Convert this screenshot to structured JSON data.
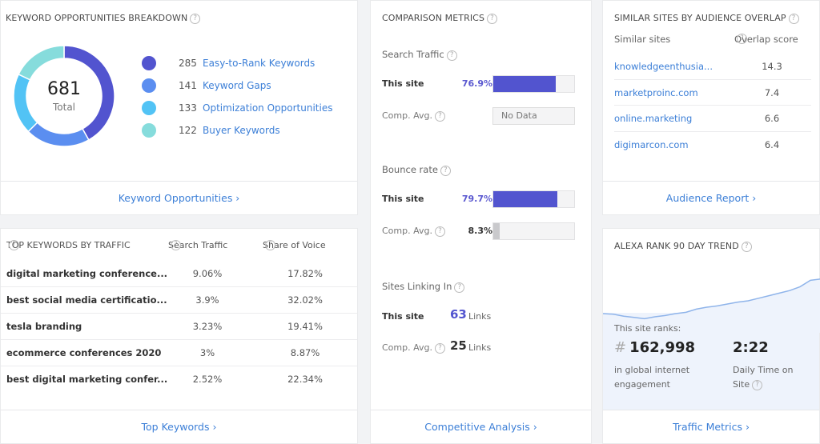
{
  "keyword_opportunities": {
    "title": "KEYWORD OPPORTUNITIES BREAKDOWN",
    "total": "681",
    "total_label": "Total",
    "items": [
      {
        "count": "285",
        "label": "Easy-to-Rank Keywords",
        "value": 285,
        "color": "#5254cf"
      },
      {
        "count": "141",
        "label": "Keyword Gaps",
        "value": 141,
        "color": "#5b8ef0"
      },
      {
        "count": "133",
        "label": "Optimization Opportunities",
        "value": 133,
        "color": "#52c3f5"
      },
      {
        "count": "122",
        "label": "Buyer Keywords",
        "value": 122,
        "color": "#86dcdc"
      }
    ],
    "footer_link": "Keyword Opportunities ›"
  },
  "top_keywords": {
    "title": "TOP KEYWORDS BY TRAFFIC",
    "col_search_traffic": "Search Traffic",
    "col_share_of_voice": "Share of Voice",
    "rows": [
      {
        "keyword": "digital marketing conference...",
        "search_traffic": "9.06%",
        "share_of_voice": "17.82%"
      },
      {
        "keyword": "best social media certificatio...",
        "search_traffic": "3.9%",
        "share_of_voice": "32.02%"
      },
      {
        "keyword": "tesla branding",
        "search_traffic": "3.23%",
        "share_of_voice": "19.41%"
      },
      {
        "keyword": "ecommerce conferences 2020",
        "search_traffic": "3%",
        "share_of_voice": "8.87%"
      },
      {
        "keyword": "best digital marketing confer...",
        "search_traffic": "2.52%",
        "share_of_voice": "22.34%"
      }
    ],
    "footer_link": "Top Keywords ›"
  },
  "comparison_metrics": {
    "title": "COMPARISON METRICS",
    "this_site_label": "This site",
    "comp_avg_label": "Comp. Avg.",
    "search_traffic": {
      "title": "Search Traffic",
      "this_site_value": "76.9%",
      "this_site_fraction": 0.769,
      "comp_avg_text": "No Data"
    },
    "bounce_rate": {
      "title": "Bounce rate",
      "this_site_value": "79.7%",
      "this_site_fraction": 0.797,
      "comp_avg_value": "8.3%",
      "comp_avg_fraction": 0.083
    },
    "sites_linking_in": {
      "title": "Sites Linking In",
      "this_site_count": "63",
      "comp_avg_count": "25",
      "unit": "Links"
    },
    "accent_color": "#5254cf",
    "comp_bar_color": "#c9c9cc",
    "footer_link": "Competitive Analysis ›"
  },
  "similar_sites": {
    "title": "SIMILAR SITES BY AUDIENCE OVERLAP",
    "col_site": "Similar sites",
    "col_score": "Overlap score",
    "rows": [
      {
        "site": "knowledgeenthusia...",
        "score": "14.3"
      },
      {
        "site": "marketproinc.com",
        "score": "7.4"
      },
      {
        "site": "online.marketing",
        "score": "6.6"
      },
      {
        "site": "digimarcon.com",
        "score": "6.4"
      }
    ],
    "footer_link": "Audience Report ›"
  },
  "alexa_rank": {
    "title": "ALEXA RANK 90 DAY TREND",
    "intro": "This site ranks:",
    "rank_hash": "#",
    "rank": "162,998",
    "rank_desc": "in global internet engagement",
    "time": "2:22",
    "time_desc": "Daily Time on Site",
    "trend_relative": [
      0.3,
      0.29,
      0.26,
      0.24,
      0.22,
      0.25,
      0.27,
      0.3,
      0.32,
      0.37,
      0.4,
      0.42,
      0.45,
      0.48,
      0.5,
      0.54,
      0.58,
      0.62,
      0.66,
      0.72,
      0.82,
      0.84
    ],
    "footer_link": "Traffic Metrics ›"
  }
}
